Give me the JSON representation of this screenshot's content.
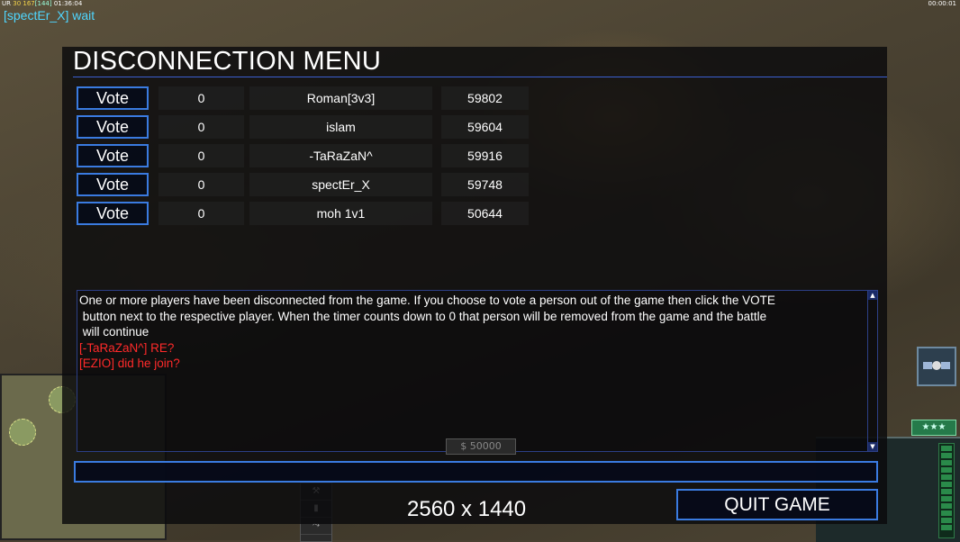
{
  "hud": {
    "top_left_prefix": "UR",
    "top_left_a": "30",
    "top_left_b": "167",
    "top_left_c": "[144]",
    "top_left_time": "01:36:04",
    "status": "[spectEr_X] wait",
    "clock": "00:00:01",
    "rank_stars": "★★★",
    "money": "$ 50000"
  },
  "dialog": {
    "title": "DISCONNECTION MENU",
    "vote_label": "Vote",
    "players": [
      {
        "count": "0",
        "name": "Roman[3v3]",
        "ping": "59802"
      },
      {
        "count": "0",
        "name": "islam",
        "ping": "59604"
      },
      {
        "count": "0",
        "name": "-TaRaZaN^",
        "ping": "59916"
      },
      {
        "count": "0",
        "name": "spectEr_X",
        "ping": "59748"
      },
      {
        "count": "0",
        "name": "moh 1v1",
        "ping": "50644"
      }
    ],
    "chat": {
      "system_lines": [
        "One or more players have been disconnected from the game. If you choose to vote a person out of the game then click the VOTE",
        " button next to the respective player. When the timer counts down to 0 that person will be removed from the game and the battle",
        " will continue"
      ],
      "messages": [
        "[-TaRaZaN^] RE?",
        "[EZIO] did he join?"
      ]
    },
    "chat_input_value": "",
    "resolution_text": "2560 x 1440",
    "quit_label": "QUIT GAME"
  }
}
